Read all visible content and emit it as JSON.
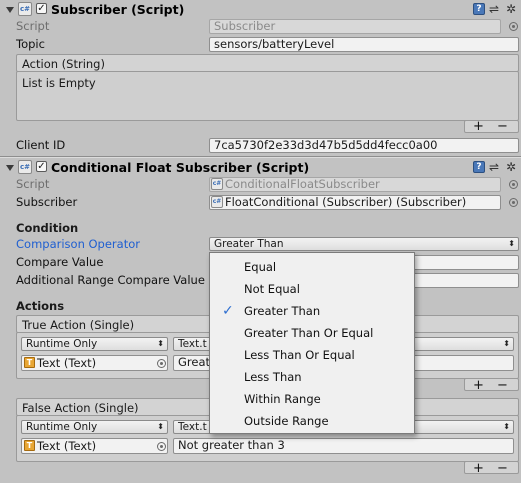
{
  "subscriber": {
    "title": "Subscriber (Script)",
    "script_label": "Script",
    "script_value": "Subscriber",
    "topic_label": "Topic",
    "topic_value": "sensors/batteryLevel",
    "action_header": "Action (String)",
    "list_empty": "List is Empty",
    "plus": "+",
    "minus": "−",
    "client_id_label": "Client ID",
    "client_id_value": "7ca5730f2e33d3d47b5d5dd4fecc0a00"
  },
  "conditional": {
    "title": "Conditional Float Subscriber (Script)",
    "script_label": "Script",
    "script_value": "ConditionalFloatSubscriber",
    "subscriber_label": "Subscriber",
    "subscriber_value": "FloatConditional (Subscriber) (Subscriber)",
    "condition_heading": "Condition",
    "comparison_label": "Comparison Operator",
    "comparison_value": "Greater Than",
    "compare_value_label": "Compare Value",
    "additional_label": "Additional Range Compare Value",
    "actions_heading": "Actions",
    "true_action": {
      "header": "True Action (Single)",
      "mode": "Runtime Only",
      "function": "Text.t",
      "target": "Text (Text)",
      "argument": "Great"
    },
    "false_action": {
      "header": "False Action (Single)",
      "mode": "Runtime Only",
      "function": "Text.t",
      "target": "Text (Text)",
      "argument": "Not greater than 3"
    },
    "plus": "+",
    "minus": "−"
  },
  "icons": {
    "help": "?",
    "checkbox_check": "✓",
    "cs": "c#",
    "t": "T",
    "dropdown_arrow": "⬍",
    "gear": "✲",
    "preset": "⇌"
  },
  "popup": {
    "selected": "Greater Than",
    "check": "✓",
    "items": [
      "Equal",
      "Not Equal",
      "Greater Than",
      "Greater Than Or Equal",
      "Less Than Or Equal",
      "Less Than",
      "Within Range",
      "Outside Range"
    ]
  },
  "colors": {
    "background": "#c2c2c2",
    "highlight_label": "#1f5fd1",
    "check": "#2f6fd0"
  }
}
